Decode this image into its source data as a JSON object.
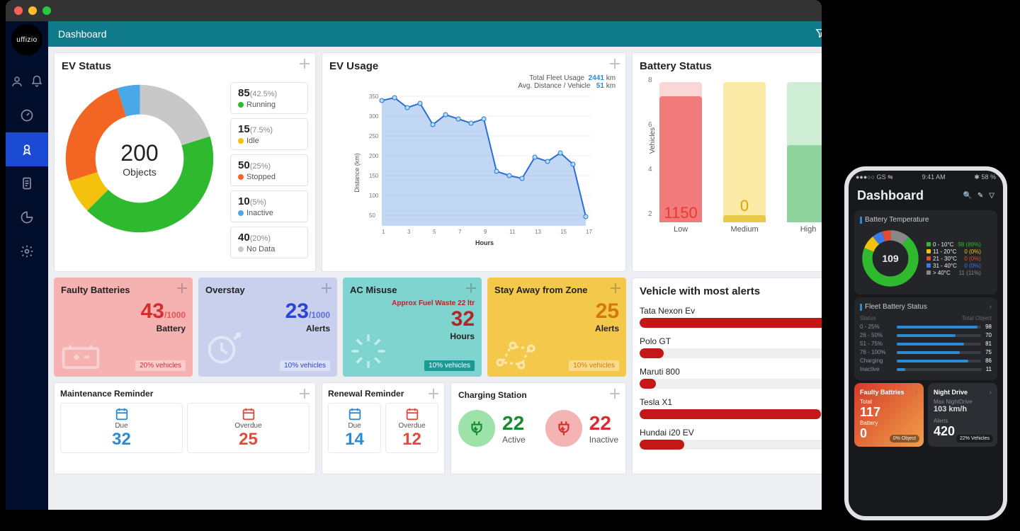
{
  "desktop": {
    "brand": "uffizio",
    "topbar_title": "Dashboard"
  },
  "ev_status": {
    "title": "EV Status",
    "total": "200",
    "total_label": "Objects",
    "items": [
      {
        "n": "85",
        "p": "(42.5%)",
        "label": "Running",
        "color": "#2fb92f"
      },
      {
        "n": "15",
        "p": "(7.5%)",
        "label": "Idle",
        "color": "#f4c20d"
      },
      {
        "n": "50",
        "p": "(25%)",
        "label": "Stopped",
        "color": "#f26522"
      },
      {
        "n": "10",
        "p": "(5%)",
        "label": "Inactive",
        "color": "#4aa8e8"
      },
      {
        "n": "40",
        "p": "(20%)",
        "label": "No Data",
        "color": "#c8c8c8"
      }
    ]
  },
  "ev_usage": {
    "title": "EV Usage",
    "total_label": "Total Fleet Usage",
    "total_val": "2441",
    "total_unit": "km",
    "avg_label": "Avg. Distance / Vehicle",
    "avg_val": "51",
    "avg_unit": "km",
    "xlabel": "Hours",
    "ylabel": "Distance (km)"
  },
  "battery": {
    "title": "Battery Status",
    "ylabel": "Vehicles",
    "bars": [
      {
        "label": "Low",
        "value": "1150",
        "pct": 90,
        "fill": "#f17b7b",
        "bg": "#fbd6d6",
        "txt": "#e63b2e"
      },
      {
        "label": "Medium",
        "value": "0",
        "pct": 5,
        "fill": "#e8c94a",
        "bg": "#fbe9a6",
        "txt": "#d9a500"
      },
      {
        "label": "High",
        "value": "",
        "pct": 55,
        "fill": "#8fd49e",
        "bg": "#cdeed4",
        "txt": "#2fa34a"
      }
    ],
    "ticks": [
      "8",
      "6",
      "4",
      "2"
    ]
  },
  "tiles": [
    {
      "title": "Faulty Batteries",
      "value": "43",
      "denom": "/1000",
      "sub": "Battery",
      "foot": "20% vehicles",
      "cls": "t-red"
    },
    {
      "title": "Overstay",
      "value": "23",
      "denom": "/1000",
      "sub": "Alerts",
      "foot": "10% vehicles",
      "cls": "t-blue"
    },
    {
      "title": "AC Misuse",
      "extra": "Approx Fuel Waste 22 ltr",
      "value": "32",
      "denom": "",
      "sub": "Hours",
      "foot": "10% vehicles",
      "cls": "t-cyan"
    },
    {
      "title": "Stay Away from Zone",
      "value": "25",
      "denom": "",
      "sub": "Alerts",
      "foot": "10% vehicles",
      "cls": "t-yellow"
    }
  ],
  "alerts": {
    "title": "Vehicle with most alerts",
    "rows": [
      {
        "name": "Tata Nexon Ev",
        "pct": 95
      },
      {
        "name": "Polo GT",
        "pct": 12
      },
      {
        "name": "Maruti 800",
        "pct": 8
      },
      {
        "name": "Tesla X1",
        "pct": 90
      },
      {
        "name": "Hundai i20 EV",
        "pct": 22
      }
    ]
  },
  "reminders": [
    {
      "title": "Maintenance Reminder",
      "due": "32",
      "overdue": "25"
    },
    {
      "title": "Renewal Reminder",
      "due": "14",
      "overdue": "12"
    }
  ],
  "reminder_labels": {
    "due": "Due",
    "overdue": "Overdue"
  },
  "charging": {
    "title": "Charging Station",
    "active": {
      "n": "22",
      "l": "Active"
    },
    "inactive": {
      "n": "22",
      "l": "Inactive"
    }
  },
  "chart_data": [
    {
      "type": "pie",
      "title": "EV Status",
      "categories": [
        "Running",
        "Idle",
        "Stopped",
        "Inactive",
        "No Data"
      ],
      "values": [
        85,
        15,
        50,
        10,
        40
      ],
      "total": 200
    },
    {
      "type": "area",
      "title": "EV Usage",
      "xlabel": "Hours",
      "ylabel": "Distance (km)",
      "x": [
        1,
        2,
        3,
        4,
        5,
        6,
        7,
        8,
        9,
        10,
        11,
        12,
        13,
        14,
        15,
        16,
        17
      ],
      "values": [
        340,
        350,
        320,
        335,
        280,
        310,
        300,
        290,
        300,
        170,
        160,
        150,
        200,
        190,
        210,
        180,
        50
      ],
      "ylim": [
        0,
        350
      ]
    },
    {
      "type": "bar",
      "title": "Battery Status",
      "ylabel": "Vehicles",
      "categories": [
        "Low",
        "Medium",
        "High"
      ],
      "values": [
        1150,
        0,
        null
      ],
      "ylim": [
        0,
        8
      ]
    },
    {
      "type": "bar",
      "title": "Vehicle with most alerts",
      "categories": [
        "Tata Nexon Ev",
        "Polo GT",
        "Maruti 800",
        "Tesla X1",
        "Hundai i20 EV"
      ],
      "values": [
        95,
        12,
        8,
        90,
        22
      ]
    },
    {
      "type": "pie",
      "title": "Battery Temperature (mobile)",
      "categories": [
        "0 - 10°C",
        "11 - 20°C",
        "21 - 30°C",
        "31 - 40°C",
        "> 40°C"
      ],
      "values": [
        98,
        0,
        0,
        0,
        11
      ],
      "total": 109
    }
  ],
  "phone": {
    "status_left": "●●●○○ GS ⇋",
    "status_time": "9:41 AM",
    "status_right": "✱ 58 %",
    "title": "Dashboard",
    "bt_title": "Battery Temperature",
    "bt_center": "109",
    "bt_legend": [
      {
        "sw": "#2fb92f",
        "range": "0 - 10°C",
        "val": "98 (89%)",
        "c": "#2fb92f"
      },
      {
        "sw": "#f4c20d",
        "range": "11 - 20°C",
        "val": "0 (0%)",
        "c": "#f4c20d"
      },
      {
        "sw": "#e64a2e",
        "range": "21 - 30°C",
        "val": "0 (0%)",
        "c": "#e64a2e"
      },
      {
        "sw": "#3a7be8",
        "range": "31 - 40°C",
        "val": "0 (0%)",
        "c": "#3a7be8"
      },
      {
        "sw": "#888",
        "range": "> 40°C",
        "val": "11 (11%)",
        "c": "#888"
      }
    ],
    "fb_title": "Fleet Battery Status",
    "fb_head_l": "Status",
    "fb_head_r": "Total Object",
    "fb_rows": [
      {
        "l": "0 - 25%",
        "pct": 96,
        "n": "98"
      },
      {
        "l": "26 - 50%",
        "pct": 70,
        "n": "70"
      },
      {
        "l": "51 - 75%",
        "pct": 80,
        "n": "81"
      },
      {
        "l": "76 - 100%",
        "pct": 75,
        "n": "75"
      },
      {
        "l": "Charging",
        "pct": 85,
        "n": "86"
      },
      {
        "l": "Inactive",
        "pct": 10,
        "n": "11"
      }
    ],
    "tile1": {
      "title": "Faulty Battries",
      "sub1": "Total",
      "v1": "117",
      "sub2": "Battery",
      "v2": "0",
      "pill": "0%  Object"
    },
    "tile2": {
      "title": "Night Drive",
      "sub1": "Max NightDrive",
      "v1": "103 km/h",
      "sub2": "Alerts",
      "v2": "420",
      "pill": "22% Vehicles"
    }
  }
}
